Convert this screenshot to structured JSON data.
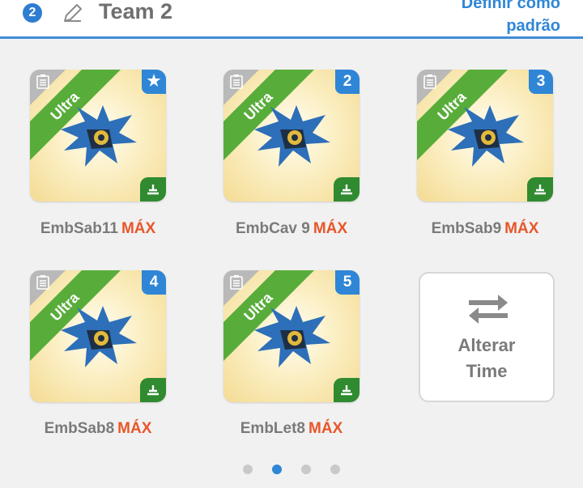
{
  "header": {
    "team_number": "2",
    "team_name": "Team 2",
    "set_default_line1": "Definir como",
    "set_default_line2": "padrão"
  },
  "cards": [
    {
      "ribbon": "Ultra",
      "position_badge": "★",
      "name": "EmbSab11",
      "level": "MÁX"
    },
    {
      "ribbon": "Ultra",
      "position_badge": "2",
      "name": "EmbCav 9",
      "level": "MÁX"
    },
    {
      "ribbon": "Ultra",
      "position_badge": "3",
      "name": "EmbSab9",
      "level": "MÁX"
    },
    {
      "ribbon": "Ultra",
      "position_badge": "4",
      "name": "EmbSab8",
      "level": "MÁX"
    },
    {
      "ribbon": "Ultra",
      "position_badge": "5",
      "name": "EmbLet8",
      "level": "MÁX"
    }
  ],
  "change_team": {
    "line1": "Alterar",
    "line2": "Time",
    "icon": "swap-arrows-icon"
  },
  "pagination": {
    "pages": 4,
    "active": 2
  },
  "colors": {
    "accent": "#2f86d6",
    "ultra": "#58ad3a",
    "max": "#e8562a",
    "element": "#2f8a30"
  }
}
